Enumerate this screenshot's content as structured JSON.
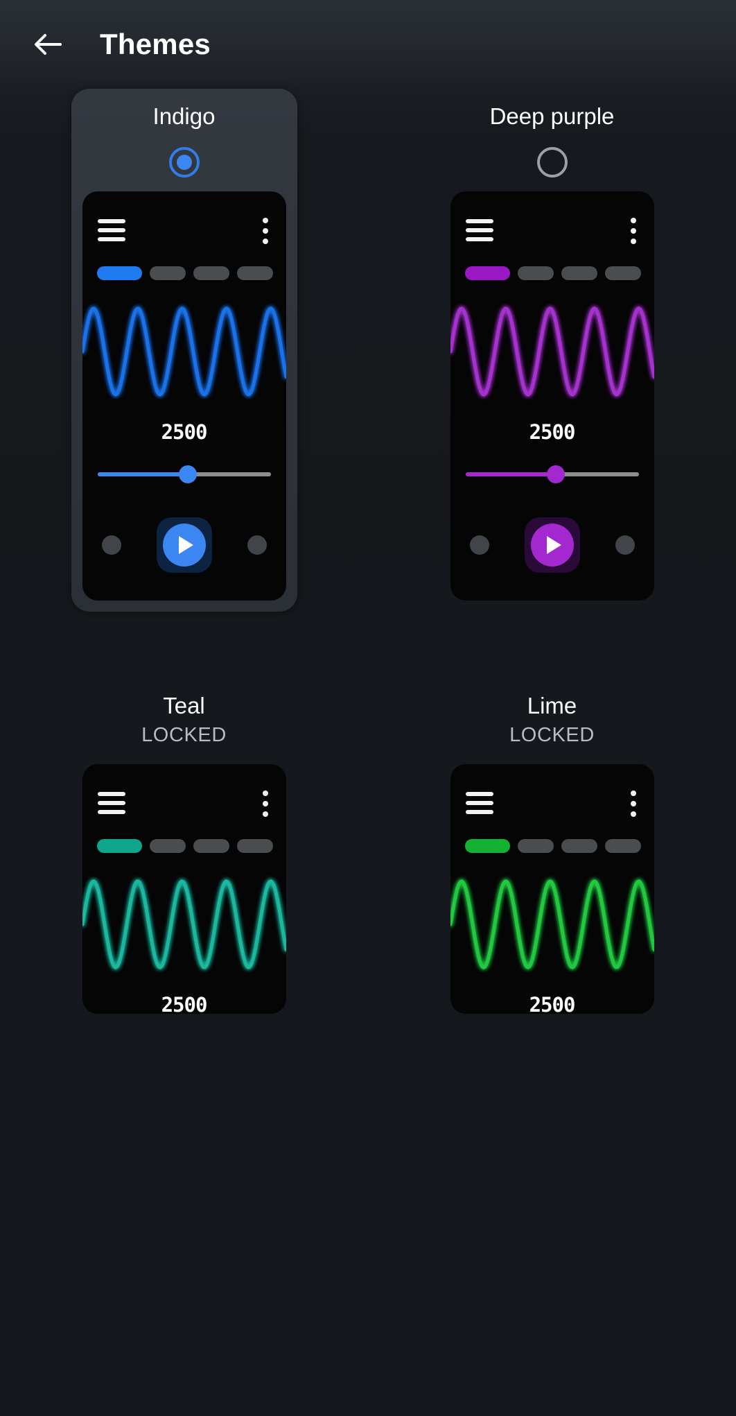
{
  "appbar": {
    "back_icon": "arrow-left-icon",
    "title": "Themes"
  },
  "preview": {
    "menu_icon": "hamburger-menu-icon",
    "overflow_icon": "kebab-menu-icon",
    "value": "2500",
    "play_icon": "play-icon",
    "slider_percent": 52,
    "pill_count": 4
  },
  "themes": [
    {
      "name": "Indigo",
      "status": "",
      "selected": true,
      "locked": false,
      "accent": "#2f7eea",
      "accent_bright": "#3b86f0",
      "wave": "#1f6fe8",
      "pill_active": "#1f7bf0",
      "play_halo": "#0d2342",
      "value": "2500"
    },
    {
      "name": "Deep purple",
      "status": "",
      "selected": false,
      "locked": false,
      "accent": "#9c21c4",
      "accent_bright": "#a428cf",
      "wave": "#a432cd",
      "pill_active": "#9a17c4",
      "play_halo": "#2a0a38",
      "value": "2500"
    },
    {
      "name": "Teal",
      "status": "LOCKED",
      "selected": false,
      "locked": true,
      "accent": "#12a08c",
      "accent_bright": "#1cb89f",
      "wave": "#1fb79d",
      "pill_active": "#0fa58d",
      "play_halo": "#06322c",
      "value": "2500"
    },
    {
      "name": "Lime",
      "status": "LOCKED",
      "selected": false,
      "locked": true,
      "accent": "#16a833",
      "accent_bright": "#22c23f",
      "wave": "#23c840",
      "pill_active": "#13b031",
      "play_halo": "#06320f",
      "value": "2500"
    }
  ]
}
